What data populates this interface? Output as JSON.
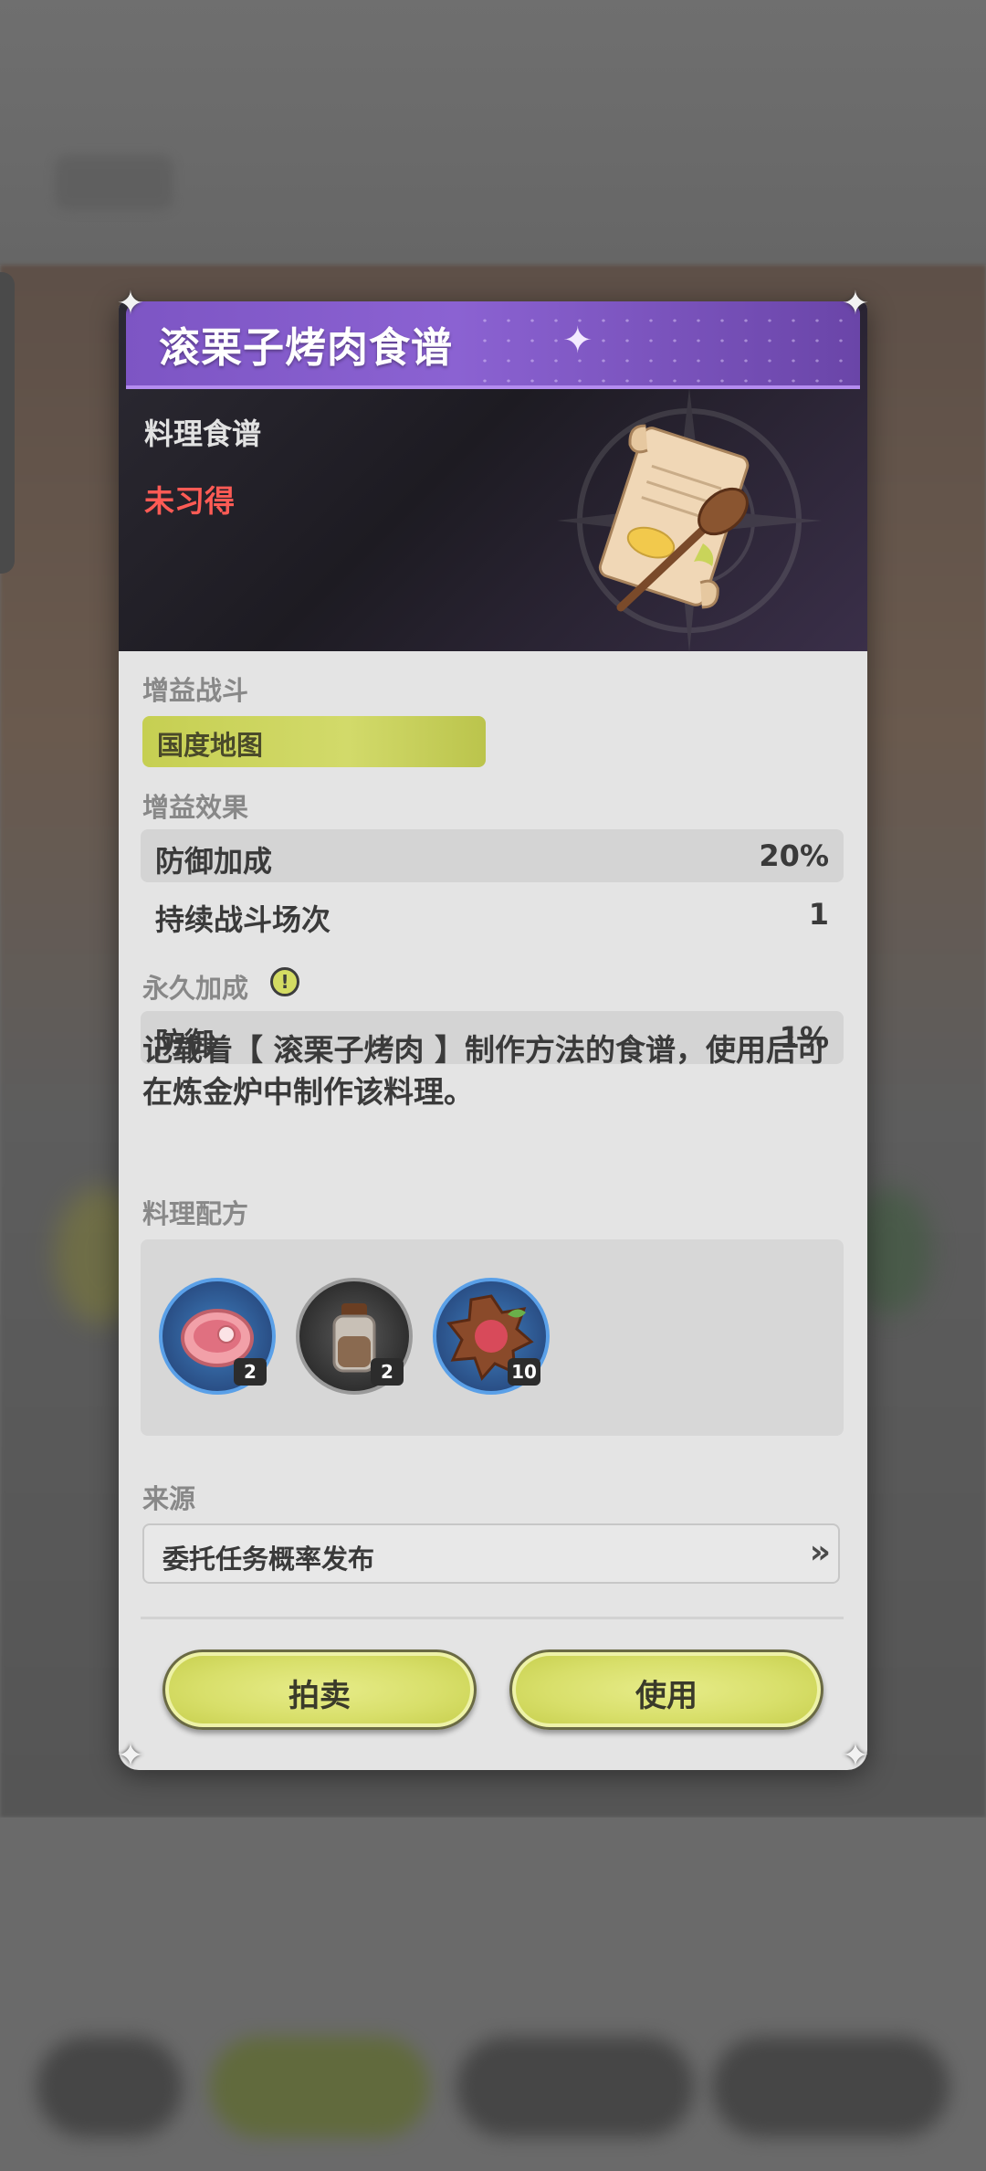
{
  "dialog": {
    "title": "滚栗子烤肉食谱",
    "item_type": "料理食谱",
    "status": "未习得",
    "status_color": "#ff5b55",
    "accent_color": "#d2da6a"
  },
  "buff_battle": {
    "label": "增益战斗",
    "tag": "国度地图"
  },
  "buff_effect": {
    "label": "增益效果",
    "rows": [
      {
        "name": "防御加成",
        "value": "20%"
      },
      {
        "name": "持续战斗场次",
        "value": "1"
      }
    ]
  },
  "permanent": {
    "label": "永久加成",
    "info_icon": "info-icon",
    "rows": [
      {
        "name": "防御",
        "value": "1%"
      }
    ]
  },
  "description": "记载着【 滚栗子烤肉 】制作方法的食谱，使用后可在炼金炉中制作该料理。",
  "ingredients": {
    "label": "料理配方",
    "items": [
      {
        "icon": "raw-meat-icon",
        "count": "2"
      },
      {
        "icon": "spice-jar-icon",
        "count": "2"
      },
      {
        "icon": "chestnut-icon",
        "count": "10"
      }
    ]
  },
  "source": {
    "label": "来源",
    "text": "委托任务概率发布",
    "chevron": "»"
  },
  "buttons": {
    "auction": "拍卖",
    "use": "使用"
  }
}
